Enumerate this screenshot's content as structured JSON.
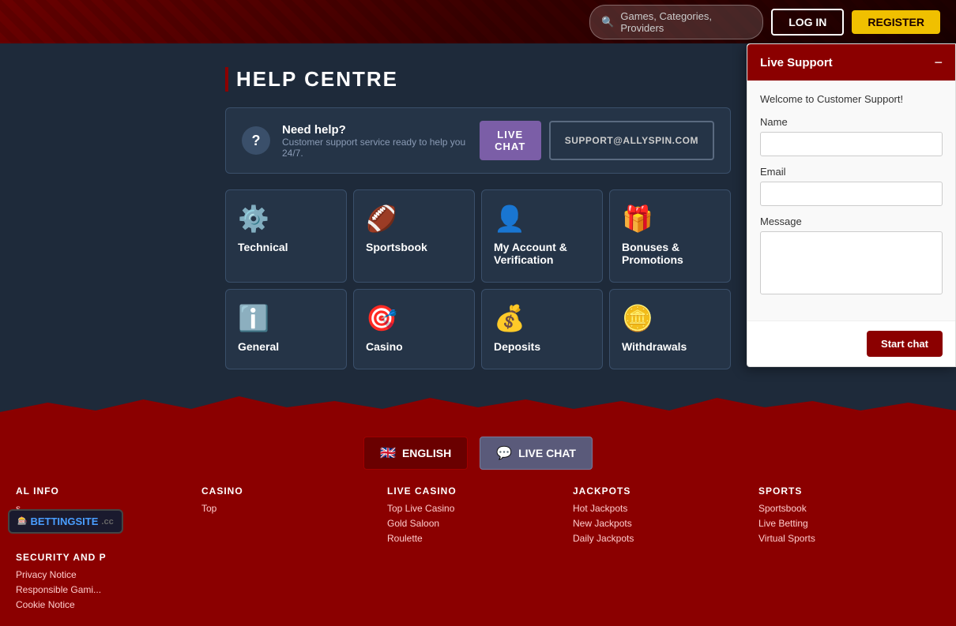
{
  "header": {
    "search_placeholder": "Games, Categories, Providers",
    "login_label": "LOG IN",
    "register_label": "REGISTER"
  },
  "main": {
    "title": "HELP CENTRE",
    "need_help": {
      "icon": "?",
      "heading": "Need help?",
      "subtext": "Customer support service ready to help you 24/7.",
      "live_chat_label": "LIVE CHAT",
      "support_email_label": "SUPPORT@ALLYSPIN.COM"
    },
    "categories": [
      {
        "icon": "⚙️",
        "label": "Technical"
      },
      {
        "icon": "🏈",
        "label": "Sportsbook"
      },
      {
        "icon": "👤",
        "label": "My Account & Verification"
      },
      {
        "icon": "🎁",
        "label": "Bonuses & Promotions"
      },
      {
        "icon": "ℹ️",
        "label": "General"
      },
      {
        "icon": "🎯",
        "label": "Casino"
      },
      {
        "icon": "💰",
        "label": "Deposits"
      },
      {
        "icon": "🪙",
        "label": "Withdrawals"
      }
    ]
  },
  "footer": {
    "lang_label": "ENGLISH",
    "livechat_label": "LIVE CHAT",
    "columns": [
      {
        "heading": "AL INFO",
        "links": [
          "s"
        ]
      },
      {
        "heading": "CASINO",
        "links": [
          "Top"
        ]
      },
      {
        "heading": "LIVE CASINO",
        "links": [
          "Top Live Casino",
          "Gold Saloon",
          "Roulette"
        ]
      },
      {
        "heading": "JACKPOTS",
        "links": [
          "Hot Jackpots",
          "New Jackpots",
          "Daily Jackpots"
        ]
      },
      {
        "heading": "SPORTS",
        "links": [
          "Sportsbook",
          "Live Betting",
          "Virtual Sports"
        ]
      },
      {
        "heading": "SECURITY AND P",
        "links": [
          "Privacy Notice",
          "Responsible Gami...",
          "Cookie Notice"
        ]
      }
    ]
  },
  "live_support": {
    "title": "Live Support",
    "minimize_icon": "−",
    "welcome": "Welcome to Customer Support!",
    "name_label": "Name",
    "email_label": "Email",
    "message_label": "Message",
    "start_chat_label": "Start chat"
  },
  "logo": {
    "text": "BETTINGSITE",
    "cc": ".cc"
  }
}
